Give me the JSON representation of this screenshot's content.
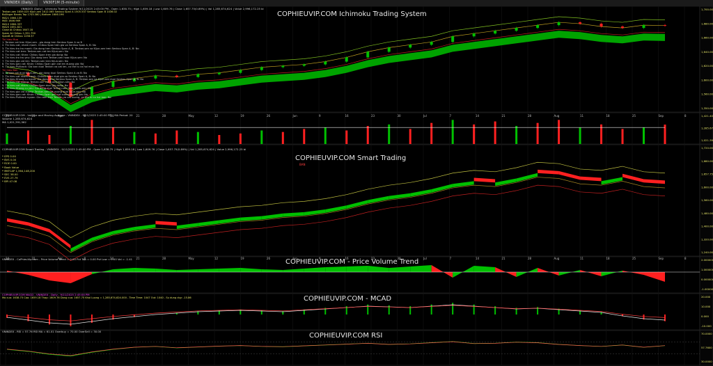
{
  "tabs": [
    {
      "label": "VNINDEX (Daily)"
    },
    {
      "label": "VN30F1M (5-minute)"
    }
  ],
  "panels": {
    "ichimoku": {
      "watermark": "COPHIEUVIP.COM Ichimoku Trading System",
      "header": "VNINDEX (Daily) - Ichimoku Trading System 9/11/2025 2:45:00 PM - Open 1,638.75 | High 1,659.18 | Low 1,609.76 | Close 1,657.75(0.89%) | Vol 1,285,674,624 | Value 2,996,172.25 bi",
      "legend": [
        {
          "text": "Tenkan-sen 1659.025  Kijun-sen 1612.065  Senkou Span A 1505.537  Senkou Span B 1436.02",
          "color": "#e8e86a"
        },
        {
          "text": "Bollinger Bands Top 1703.380 | Bottom 1606.196",
          "color": "#e8e86a"
        },
        {
          "text": "MA21 1664.135",
          "color": "#e8e86a"
        },
        {
          "text": "MA5 1646.969",
          "color": "#e8e86a"
        },
        {
          "text": "MA10 1664.337",
          "color": "#e8e86a"
        },
        {
          "text": "MA20 1651.821",
          "color": "#e8e86a"
        },
        {
          "text": "Close At Chikou 1647.16",
          "color": "#e8e86a"
        },
        {
          "text": "Spam At Chikou 1,351.790",
          "color": "#e8e86a"
        },
        {
          "text": "SpanB At Chikou 1256.57",
          "color": "#e8e86a"
        },
        {
          "text": "Tin hieu Mua",
          "color": "#ff4040"
        },
        {
          "text": "1. Tenkan cat tren Kijun-sen - gia dong tren Senkou Span A va B",
          "color": "#cccccc"
        },
        {
          "text": "2. Tin hieu cat, nham manh. Chikou Span tren gia va Senkou Span A, B: No",
          "color": "#cccccc"
        },
        {
          "text": "3. Tin hieu tro tro manh: Gia dong tren Senkou Span A, B. Tenkan-sen va Kijun-sen tren Senkou Span A, B: No",
          "color": "#cccccc"
        },
        {
          "text": "4. Tin hieu cat tren: Tenkan-sen cat len Kijun-sen: No",
          "color": "#cccccc"
        },
        {
          "text": "5. Tin hieu cat: Khan: Chikou Span tren gia dong: No",
          "color": "#cccccc"
        },
        {
          "text": "6. Tin hieu tro tro yeu: Gia dong tren Tenkan-sen hoac Kijun-sen: No",
          "color": "#cccccc"
        },
        {
          "text": "7. Tin hieu gia cat len: Tenkan-sen tren Kijun-sen: No",
          "color": "#cccccc"
        },
        {
          "text": "8. Tin hieu gan cat: Khan: Chikou Span gan cat len duong gia: No",
          "color": "#cccccc"
        },
        {
          "text": "9. Tin hieu Pullback: Gia ban duoi Tenkan va cat len, co the tu ca hoi mua: No",
          "color": "#cccccc"
        },
        {
          "text": "Tin hieu Ban",
          "color": "#ff4040"
        },
        {
          "text": "1. Tenkan cat duoi Kijun-sen, gia dong duoi Senkou Span A va B: No",
          "color": "#cccccc"
        },
        {
          "text": "2. Tin hieu cat nham manh: Chikou Span duoi gia va Senkou Span A, B: No",
          "color": "#cccccc"
        },
        {
          "text": "3. Tin hieu Khang cu manh: Gia dong duoi Senkou Span A, B. Tenkan-sen va Kijun-sen duoi Senkou Span A, B: No",
          "color": "#cccccc"
        },
        {
          "text": "4. Tin hieu cat xuong: Tenkan-sen cat xuong Kijun-sen: No",
          "color": "#cccccc"
        },
        {
          "text": "5. Tin hieu cat nham: Chikou Span duoi gia dong: No",
          "color": "#cccccc"
        },
        {
          "text": "6. Tin hieu Khang cu yeu: Gia dong duoi Tenkan-sen hoac Kijun-sen: No",
          "color": "#cccccc"
        },
        {
          "text": "7. Tin hieu gia cat xuong: Tenkan-sen cat xuong duoi Kijun-sen: No",
          "color": "#cccccc"
        },
        {
          "text": "8. Tin hieu gan cat: Khan: Chikou Span gan cat xuong duong gia: No",
          "color": "#cccccc"
        },
        {
          "text": "9. Tin hieu Pullback nguoc: Gia nam tren Tenkan va cat xuong, co the tu co hoi ban: No",
          "color": "#cccccc"
        }
      ],
      "axis_labels": [
        "1,700.00",
        "1,680.00",
        "1,660.00",
        "1,640.00",
        "1,620.00",
        "1,600.00",
        "1,560.00",
        "1,350.00"
      ]
    },
    "volume": {
      "header": "COPHIEUVIP.COM - Volume and Moving Average - VNINDEX - 9/11/2025 2:45:00 PM | MA Period: 20",
      "line2": "Volume 1,285,674,624",
      "line3": "MA 1,021,391,562",
      "axis_labels": [
        "1,421.40",
        "1,285.67",
        "1,021.39"
      ]
    },
    "smart": {
      "watermark": "COPHIEUVIP.COM Smart Trading",
      "header": "COPHIEUVIP.COM Smart Trading - VNINDEX - 9/11/2025 2:45:00 PM - Open 1,638.75 | High 1,659.18 | Low 1,609.76 | Close 1,657.75(0.89%) | Vol 1,285,674,624 | Value 2,996,172.25 bi",
      "stats": [
        "* EPS 0.00",
        "* BVS 0.00",
        "* ROE 0.00",
        "* Book Value",
        "* MKTCAP 1,364,148,200",
        "* SEC 38.00",
        "* EVS 27.79",
        "* BPI 47.08"
      ],
      "signal_label": "BAN",
      "axis_labels": [
        "1,720.00",
        "1,680.00",
        "1,657.75",
        "1,600.00",
        "1,560.00",
        "1,480.00",
        "1,400.00",
        "1,320.00",
        "1,240.00"
      ]
    },
    "pvt": {
      "watermark": "COPHIEUVIP.COM - Price Volume Trend",
      "header": "VNINDEX - CoPhieuVip.com - Price Volume Trend = 0.00  Pvt Top = 0.00  Pvt Low = 0.00  Val = -1.41",
      "axis_labels": [
        "2.000000",
        "1.000000",
        "0.000000",
        "-1.000000"
      ]
    },
    "macd": {
      "watermark": "COPHIEUVIP.COM - MCAD",
      "header": "COPHIEUVIP.COM MACD - VNINDEX - Daily - 9/11/2025 2:45:00 PM",
      "line2": "Mo cua: 1638.75  Cao: 1659.18  Thap: 1609.76  Dong cua: 1657.75  Khoi Luong = 1,285,674,624.000 - Time Time: 1047  Out: 1040  - Su dung duy: -15.86",
      "axis_labels": [
        "20.000",
        "10.000",
        "0.000",
        "-10.000"
      ]
    },
    "rsi": {
      "watermark": "COPHIEUVIP.COM RSI",
      "header": "VNINDEX - RSI = 57.76  RSI MA = 61.01  Overbuy = 70.00  OverSell = 30.00",
      "axis_labels": [
        "70.0000",
        "57.7600",
        "30.0000"
      ]
    }
  },
  "x_axis_labels": [
    "24",
    "31",
    "Apr",
    "8",
    "14",
    "21",
    "28",
    "May",
    "12",
    "19",
    "26",
    "Jun",
    "9",
    "16",
    "23",
    "30",
    "Jul",
    "7",
    "14",
    "21",
    "28",
    "Aug",
    "11",
    "18",
    "25",
    "Sep",
    "8"
  ],
  "chart_data": [
    {
      "type": "line",
      "title": "COPHIEUVIP.COM Ichimoku Trading System",
      "series": [
        {
          "name": "",
          "values": [
            1320,
            1300,
            1250,
            1150,
            1220,
            1260,
            1280,
            1300,
            1290,
            1310,
            1320,
            1340,
            1360,
            1370,
            1380,
            1400,
            1430,
            1470,
            1500,
            1520,
            1540,
            1580,
            1600,
            1620,
            1640,
            1660,
            1680,
            1670,
            1650,
            1640,
            1660,
            1657
          ]
        }
      ]
    },
    {
      "type": "bar",
      "series": [
        {
          "name": "",
          "values": [
            0.7,
            0.9,
            0.6,
            1.2,
            1.6,
            1.1,
            0.8,
            0.7,
            0.9,
            0.8,
            0.6,
            0.7,
            0.9,
            0.8,
            1.0,
            1.1,
            0.9,
            1.2,
            1.3,
            1.0,
            1.4,
            1.6,
            1.3,
            1.5,
            1.2,
            1.4,
            1.6,
            1.1,
            1.3,
            1.0,
            1.1,
            1.29
          ]
        }
      ]
    },
    {
      "type": "area",
      "title": "COPHIEUVIP.COM Smart Trading",
      "series": [
        {
          "name": "",
          "values": [
            1320,
            1290,
            1240,
            1120,
            1200,
            1250,
            1280,
            1300,
            1290,
            1310,
            1330,
            1350,
            1360,
            1380,
            1390,
            1410,
            1440,
            1480,
            1510,
            1530,
            1560,
            1600,
            1620,
            1610,
            1640,
            1680,
            1670,
            1630,
            1620,
            1650,
            1610,
            1600
          ]
        }
      ]
    },
    {
      "type": "area",
      "title": "COPHIEUVIP.COM - Price Volume Trend",
      "series": [
        {
          "name": "",
          "values": [
            0.2,
            -0.4,
            -1.2,
            -1.6,
            -0.3,
            0.4,
            0.6,
            0.5,
            0.3,
            0.4,
            0.5,
            0.6,
            0.4,
            0.3,
            0.5,
            0.7,
            0.8,
            0.9,
            0.6,
            0.8,
            1.0,
            -0.8,
            0.9,
            0.7,
            -0.7,
            0.6,
            -0.5,
            0.3,
            -0.6,
            0.2,
            -0.4,
            -1.4
          ]
        }
      ]
    },
    {
      "type": "bar",
      "title": "COPHIEUVIP.COM - MCAD",
      "series": [
        {
          "name": "",
          "values": [
            -4,
            -8,
            -12,
            -14,
            -10,
            -6,
            -3,
            0,
            2,
            4,
            5,
            6,
            5,
            4,
            6,
            8,
            10,
            12,
            11,
            10,
            12,
            14,
            12,
            10,
            8,
            9,
            7,
            5,
            3,
            -2,
            -6,
            -8
          ]
        }
      ]
    },
    {
      "type": "line",
      "title": "COPHIEUVIP.COM RSI",
      "series": [
        {
          "name": "",
          "values": [
            45,
            38,
            28,
            22,
            35,
            45,
            52,
            55,
            50,
            53,
            56,
            58,
            55,
            54,
            57,
            60,
            63,
            66,
            62,
            64,
            68,
            72,
            65,
            66,
            70,
            68,
            62,
            58,
            55,
            60,
            52,
            57.76
          ]
        }
      ]
    }
  ],
  "colors": {
    "up": "#00c000",
    "down": "#ff2020",
    "cloud_green": "#00c000",
    "cloud_red": "#cc0000",
    "line_yellow": "#d0d040"
  }
}
